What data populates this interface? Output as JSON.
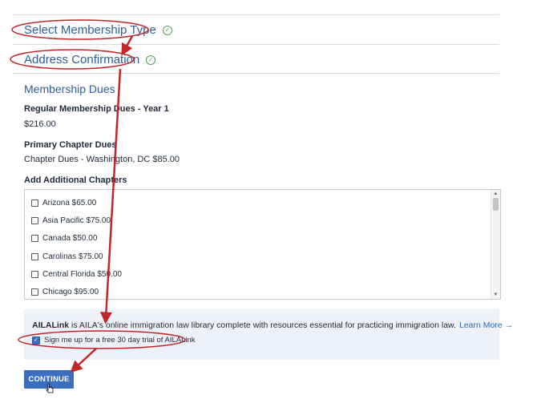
{
  "steps": [
    {
      "title": "Select Membership Type",
      "status_icon": "check-circle-icon"
    },
    {
      "title": "Address Confirmation",
      "status_icon": "check-circle-icon"
    }
  ],
  "dues": {
    "section_title": "Membership Dues",
    "regular_label": "Regular Membership Dues - Year 1",
    "regular_value": "$216.00",
    "primary_label": "Primary Chapter Dues",
    "primary_value": "Chapter Dues - Washington, DC $85.00",
    "additional_label": "Add Additional Chapters"
  },
  "chapters": [
    {
      "label": "Arizona $65.00",
      "checked": false
    },
    {
      "label": "Asia Pacific $75.00",
      "checked": false
    },
    {
      "label": "Canada $50.00",
      "checked": false
    },
    {
      "label": "Carolinas $75.00",
      "checked": false
    },
    {
      "label": "Central Florida $50.00",
      "checked": false
    },
    {
      "label": "Chicago $95.00",
      "checked": false
    }
  ],
  "ailalink": {
    "brand": "AILALink",
    "description": " is AILA's online immigration law library complete with resources essential for practicing immigration law.",
    "learn_more": "Learn More →",
    "trial_label": "Sign me up for a free 30 day trial of AILALink",
    "trial_checked": true
  },
  "continue_label": "CONTINUE",
  "colors": {
    "accent": "#2f5d9a",
    "button": "#3c6ebf",
    "annotation": "#c0262a",
    "panel": "#eef2f8"
  }
}
